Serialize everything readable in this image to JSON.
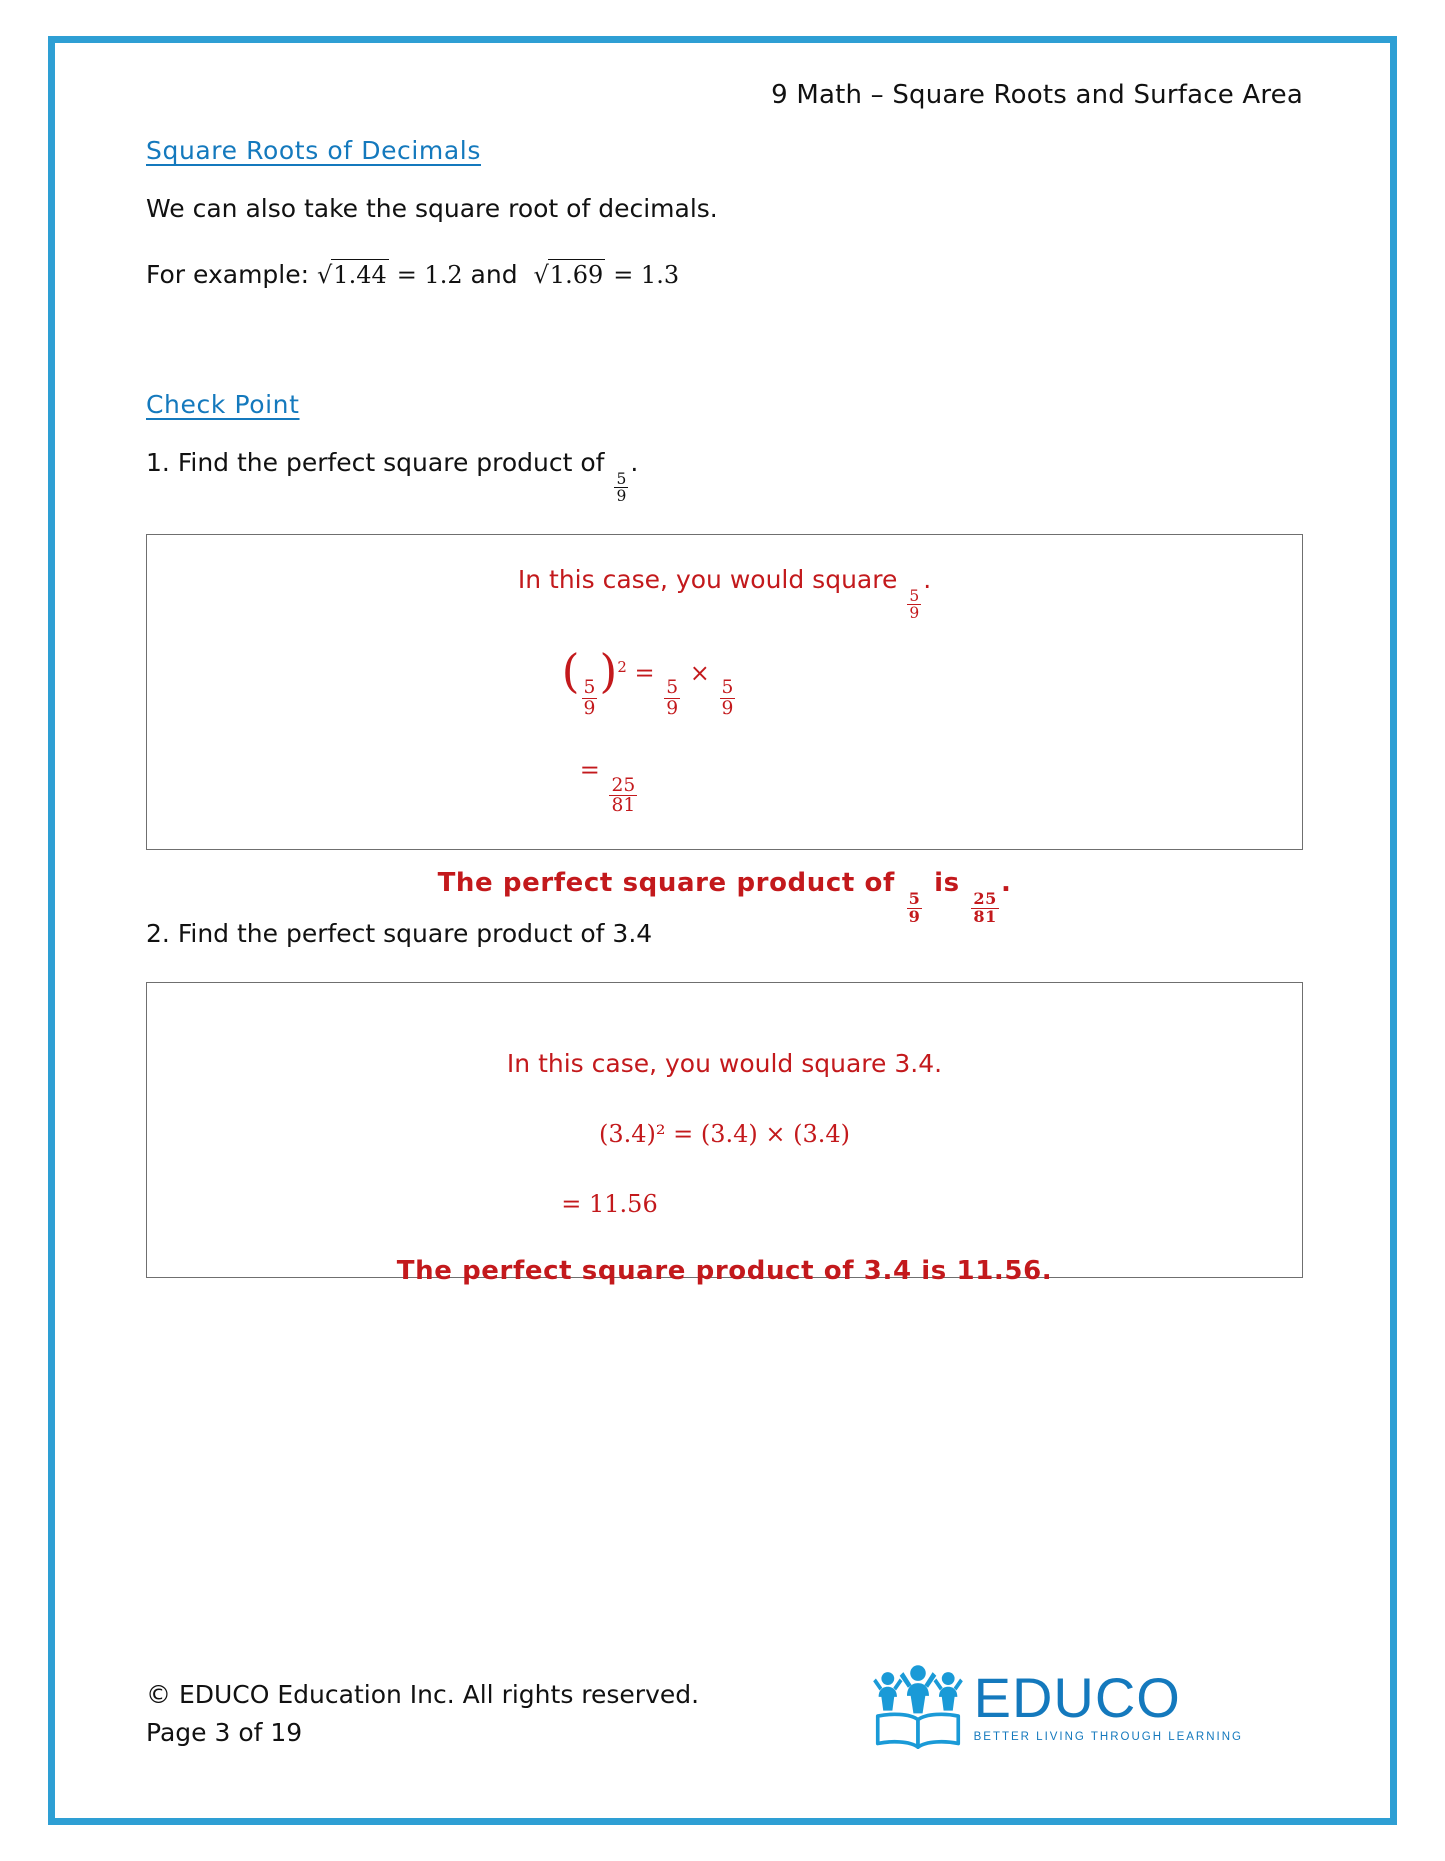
{
  "document": {
    "header_title": "9 Math – Square Roots and Surface Area",
    "accent_color": "#2e9fd4",
    "heading_color": "#1479bd",
    "answer_color": "#c3191c"
  },
  "sections": {
    "decimals": {
      "heading": "Square Roots of Decimals",
      "paragraph": "We can also take the square root of decimals.",
      "example": {
        "lead": "For example:",
        "root1_radicand": "1.44",
        "equals1": "= 1.2",
        "conjunction": "and",
        "root2_radicand": "1.69",
        "equals2": "= 1.3"
      }
    },
    "check_point": {
      "heading": "Check Point",
      "questions": [
        {
          "number": "1.",
          "text_before": "Find the perfect square product of",
          "fraction": {
            "num": "5",
            "den": "9"
          },
          "text_after": ".",
          "answer": {
            "intro_before": "In this case, you would square",
            "intro_fraction": {
              "num": "5",
              "den": "9"
            },
            "intro_after": ".",
            "step1_base": {
              "num": "5",
              "den": "9"
            },
            "step1_exponent": "2",
            "step1_equals": "=",
            "step1_factor1": {
              "num": "5",
              "den": "9"
            },
            "step1_times": "×",
            "step1_factor2": {
              "num": "5",
              "den": "9"
            },
            "step2_equals": "=",
            "step2_result": {
              "num": "25",
              "den": "81"
            },
            "conclusion_a": "The perfect square product of",
            "conclusion_fraction1": {
              "num": "5",
              "den": "9"
            },
            "conclusion_b": "is",
            "conclusion_fraction2": {
              "num": "25",
              "den": "81"
            },
            "conclusion_c": "."
          }
        },
        {
          "number": "2.",
          "text_before": "Find the perfect square product of 3.4",
          "answer": {
            "intro": "In this case, you would square 3.4.",
            "step1": "(3.4)² =  (3.4) × (3.4)",
            "step2": "=  11.56",
            "conclusion": "The perfect square product of 3.4 is 11.56."
          }
        }
      ]
    }
  },
  "footer": {
    "copyright": "© EDUCO Education Inc. All rights reserved.",
    "page_label": "Page 3 of 19",
    "logo_word": "EDUCO",
    "logo_tagline": "BETTER LIVING THROUGH LEARNING"
  }
}
